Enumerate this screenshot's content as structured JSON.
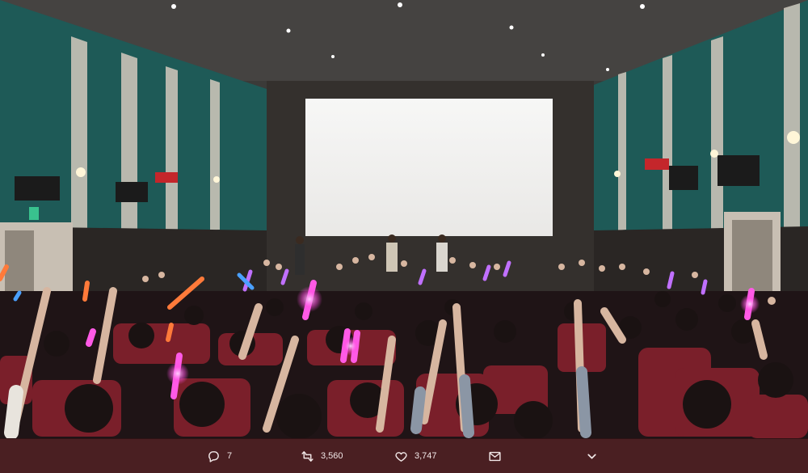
{
  "tweet": {
    "actions": {
      "reply_count": "7",
      "retweet_count": "3,560",
      "like_count": "3,747"
    },
    "icons": {
      "reply": "reply-bubble-icon",
      "retweet": "retweet-icon",
      "like": "heart-icon",
      "message": "envelope-icon",
      "more": "chevron-down-icon"
    },
    "colors": {
      "action_bar": "#4a1f22",
      "action_text": "#f2e8e8",
      "screen": "#f4f3f1",
      "wall_teal": "#1e5a57",
      "seat_red": "#7a1f2a",
      "penlight_pink": "#ff4fe0",
      "penlight_violet": "#c060ff"
    }
  }
}
